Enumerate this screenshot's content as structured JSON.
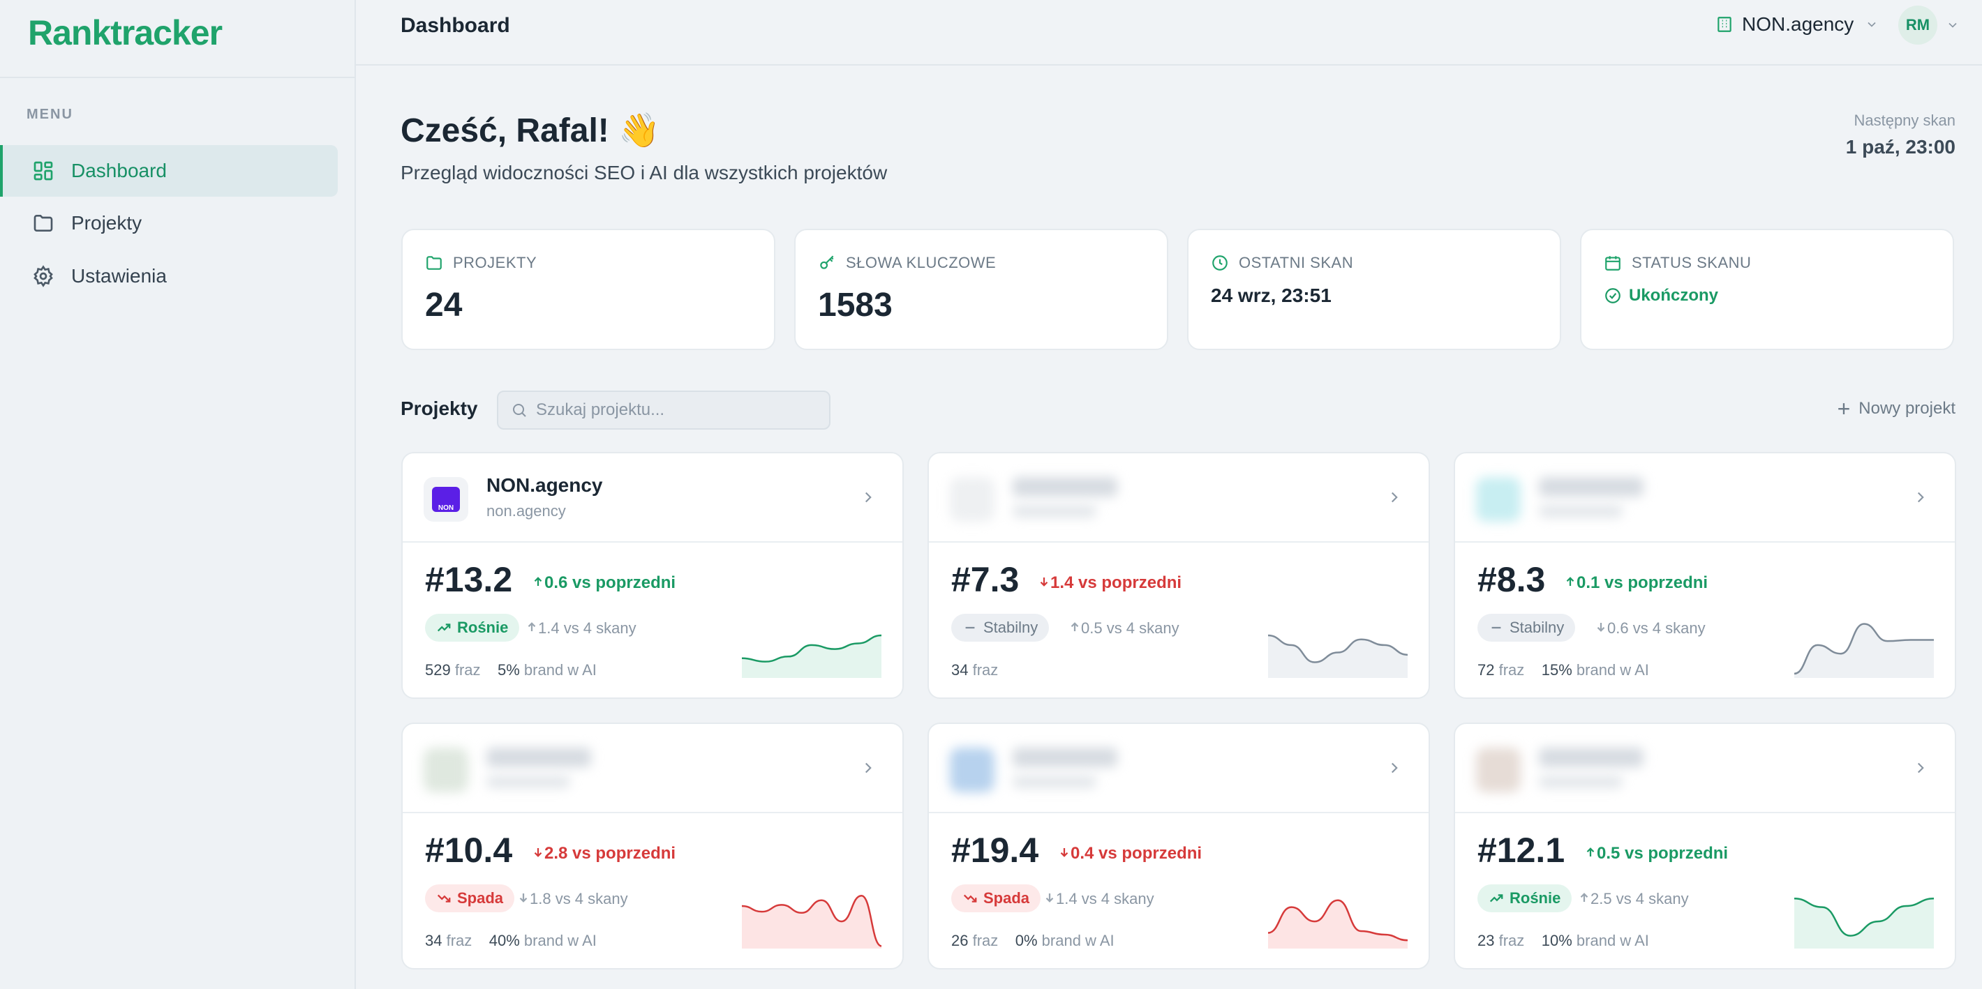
{
  "app": {
    "logo": "Ranktracker"
  },
  "sidebar": {
    "menu_label": "MENU",
    "items": [
      {
        "label": "Dashboard",
        "icon": "dashboard-grid-icon",
        "active": true
      },
      {
        "label": "Projekty",
        "icon": "folder-icon",
        "active": false
      },
      {
        "label": "Ustawienia",
        "icon": "gear-icon",
        "active": false
      }
    ]
  },
  "header": {
    "title": "Dashboard",
    "org_name": "NON.agency",
    "avatar_initials": "RM"
  },
  "greeting": {
    "title": "Cześć, Rafal! 👋",
    "subtitle": "Przegląd widoczności SEO i AI dla wszystkich projektów",
    "next_scan_label": "Następny skan",
    "next_scan_value": "1 paź, 23:00"
  },
  "stats": [
    {
      "label": "PROJEKTY",
      "value": "24",
      "icon": "folder-icon"
    },
    {
      "label": "SŁOWA KLUCZOWE",
      "value": "1583",
      "icon": "key-icon"
    },
    {
      "label": "OSTATNI SKAN",
      "value": "24 wrz, 23:51",
      "icon": "clock-icon"
    },
    {
      "label": "STATUS SKANU",
      "value": "Ukończony",
      "icon": "calendar-icon",
      "status_color": "#1a9a64"
    }
  ],
  "projects_section": {
    "title": "Projekty",
    "search_placeholder": "Szukaj projektu...",
    "new_project_label": "Nowy projekt"
  },
  "projects": [
    {
      "name": "NON.agency",
      "domain": "non.agency",
      "logo_text": "NON",
      "blurred": false,
      "rank": "#13.2",
      "delta": "0.6 vs poprzedni",
      "delta_dir": "up",
      "trend": "Rośnie",
      "trend_type": "rise",
      "scans": "1.4 vs 4 skany",
      "scans_dir": "up",
      "phrases": "529",
      "phrases_label": "fraz",
      "brand": "5%",
      "brand_label": "brand w AI",
      "spark": [
        0.32,
        0.26,
        0.35,
        0.55,
        0.48,
        0.58,
        0.72
      ]
    },
    {
      "name": "",
      "domain": "",
      "blurred": true,
      "blur_color": "#eef0f2",
      "rank": "#7.3",
      "delta": "1.4 vs poprzedni",
      "delta_dir": "down",
      "trend": "Stabilny",
      "trend_type": "flat",
      "scans": "0.5 vs 4 skany",
      "scans_dir": "up",
      "phrases": "34",
      "phrases_label": "fraz",
      "brand": "",
      "brand_label": "",
      "spark": [
        0.72,
        0.55,
        0.25,
        0.42,
        0.65,
        0.55,
        0.38
      ]
    },
    {
      "name": "",
      "domain": "",
      "blurred": true,
      "blur_color": "#c8eef2",
      "rank": "#8.3",
      "delta": "0.1 vs poprzedni",
      "delta_dir": "up",
      "trend": "Stabilny",
      "trend_type": "flat",
      "scans": "0.6 vs 4 skany",
      "scans_dir": "down",
      "phrases": "72",
      "phrases_label": "fraz",
      "brand": "15%",
      "brand_label": "brand w AI",
      "spark": [
        0.05,
        0.55,
        0.4,
        0.92,
        0.62,
        0.64,
        0.64
      ]
    },
    {
      "name": "",
      "domain": "",
      "blurred": true,
      "blur_color": "#dfe8df",
      "rank": "#10.4",
      "delta": "2.8 vs poprzedni",
      "delta_dir": "down",
      "trend": "Spada",
      "trend_type": "fall",
      "scans": "1.8 vs 4 skany",
      "scans_dir": "down",
      "phrases": "34",
      "phrases_label": "fraz",
      "brand": "40%",
      "brand_label": "brand w AI",
      "spark": [
        0.72,
        0.62,
        0.74,
        0.6,
        0.82,
        0.45,
        0.9,
        0.02
      ]
    },
    {
      "name": "",
      "domain": "",
      "blurred": true,
      "blur_color": "#b7d2ee",
      "rank": "#19.4",
      "delta": "0.4 vs poprzedni",
      "delta_dir": "down",
      "trend": "Spada",
      "trend_type": "fall",
      "scans": "1.4 vs 4 skany",
      "scans_dir": "down",
      "phrases": "26",
      "phrases_label": "fraz",
      "brand": "0%",
      "brand_label": "brand w AI",
      "spark": [
        0.25,
        0.7,
        0.45,
        0.82,
        0.28,
        0.22,
        0.12
      ]
    },
    {
      "name": "",
      "domain": "",
      "blurred": true,
      "blur_color": "#e6dcd6",
      "rank": "#12.1",
      "delta": "0.5 vs poprzedni",
      "delta_dir": "up",
      "trend": "Rośnie",
      "trend_type": "rise",
      "scans": "2.5 vs 4 skany",
      "scans_dir": "up",
      "phrases": "23",
      "phrases_label": "fraz",
      "brand": "10%",
      "brand_label": "brand w AI",
      "spark": [
        0.85,
        0.7,
        0.2,
        0.45,
        0.72,
        0.85
      ]
    }
  ],
  "colors": {
    "accent": "#1fa36b",
    "up": "#1a9a64",
    "down": "#d63a3a",
    "flat": "#7f8c99"
  }
}
